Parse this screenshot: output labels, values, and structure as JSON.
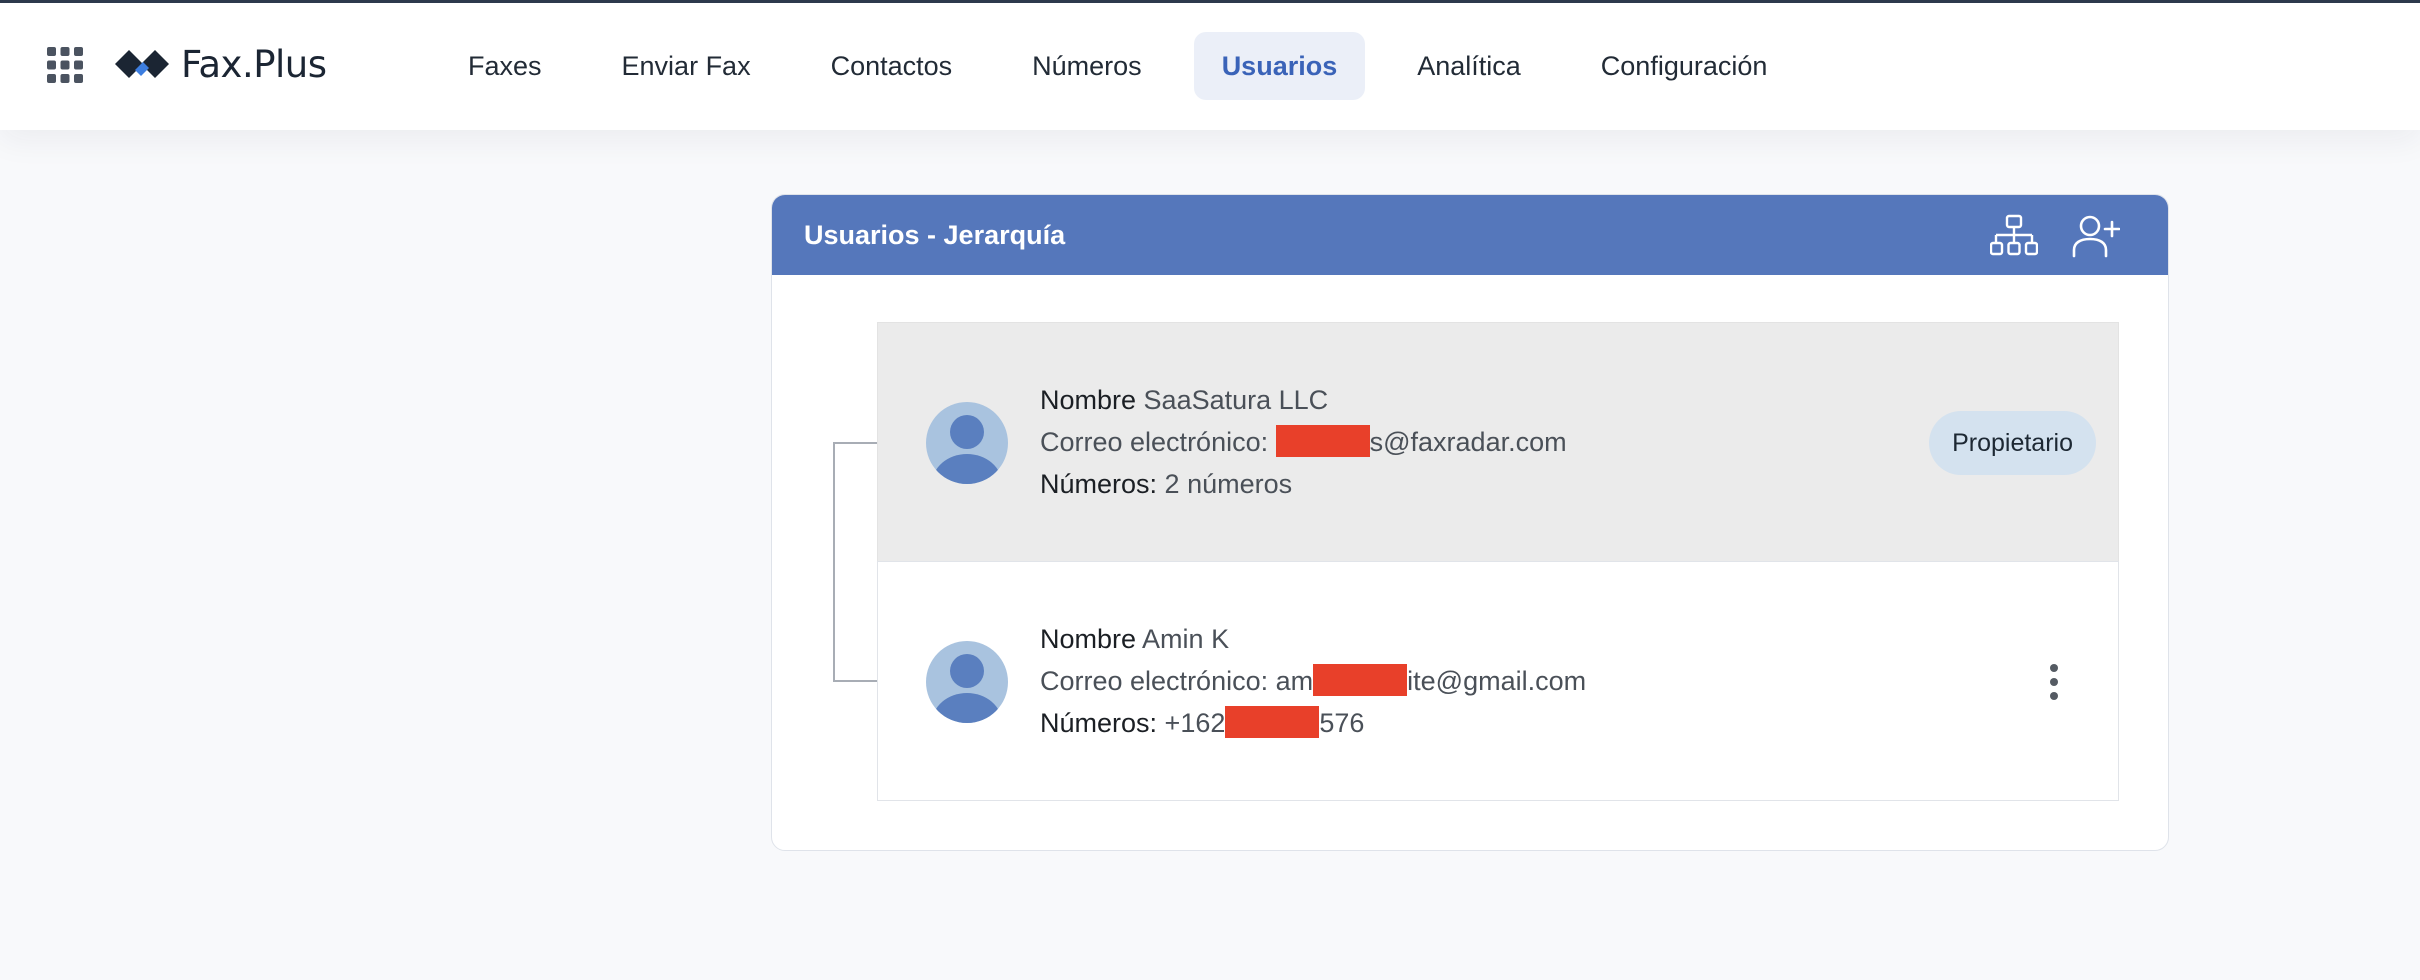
{
  "app": {
    "logo_text": "Fax.Plus",
    "accent_color": "#5577bb",
    "redaction_color": "#e8402a"
  },
  "nav": {
    "items": [
      {
        "label": "Faxes"
      },
      {
        "label": "Enviar Fax"
      },
      {
        "label": "Contactos"
      },
      {
        "label": "Números"
      },
      {
        "label": "Usuarios",
        "active": true
      },
      {
        "label": "Analítica"
      },
      {
        "label": "Configuración"
      }
    ]
  },
  "panel": {
    "title": "Usuarios - Jerarquía",
    "icons": [
      "hierarchy-icon",
      "add-user-icon"
    ]
  },
  "users": [
    {
      "name_label": "Nombre",
      "name": "SaaSatura LLC",
      "email_label": "Correo electrónico:",
      "email_prefix": "",
      "email_suffix": "s@faxradar.com",
      "numbers_label": "Números:",
      "numbers_prefix": "2 números",
      "numbers_suffix": "",
      "role_badge": "Propietario"
    },
    {
      "name_label": "Nombre",
      "name": "Amin K",
      "email_label": "Correo electrónico:",
      "email_prefix": "am",
      "email_suffix": "ite@gmail.com",
      "numbers_label": "Números:",
      "numbers_prefix": "+162",
      "numbers_suffix": "576"
    }
  ]
}
